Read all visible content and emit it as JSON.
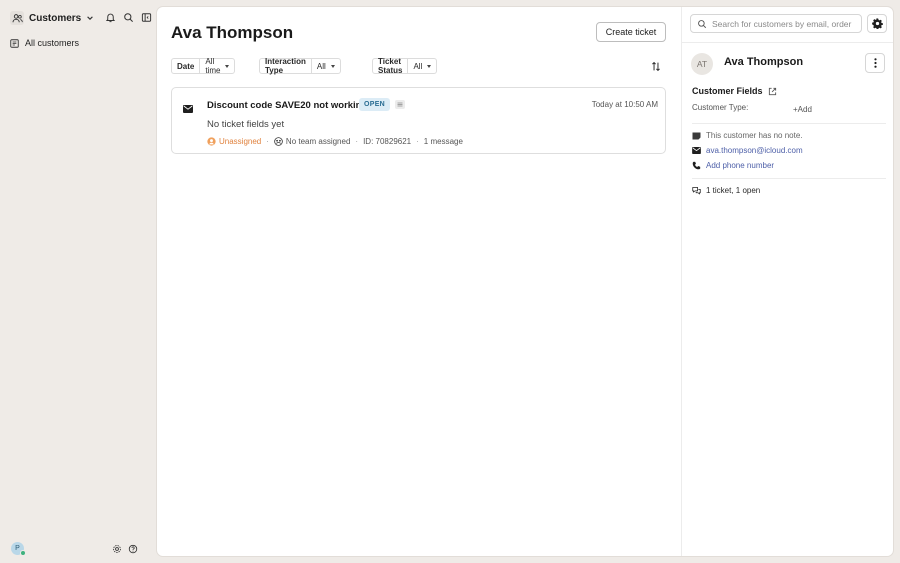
{
  "sidebar": {
    "app_label": "Customers",
    "nav_item": "All customers",
    "user_initial": "P",
    "icons": [
      "users-icon",
      "chevron-down-icon",
      "bell-icon",
      "search-icon",
      "panel-toggle-icon",
      "list-icon",
      "settings-icon",
      "help-icon"
    ]
  },
  "main": {
    "title": "Ava Thompson",
    "create_ticket_label": "Create ticket",
    "filters": [
      {
        "label": "Date",
        "value": "All time"
      },
      {
        "label": "Interaction Type",
        "value": "All"
      },
      {
        "label": "Ticket Status",
        "value": "All"
      }
    ],
    "ticket": {
      "subject": "Discount code SAVE20 not working",
      "status": "OPEN",
      "time": "Today at 10:50 AM",
      "fields_text": "No ticket fields yet",
      "assignee": "Unassigned",
      "team": "No team assigned",
      "id_text": "ID: 70829621",
      "messages": "1 message"
    }
  },
  "customer_panel": {
    "search_placeholder": "Search for customers by email, order",
    "initials": "AT",
    "name": "Ava Thompson",
    "fields_title": "Customer Fields",
    "field_label": "Customer Type:",
    "field_add": "+Add",
    "note": "This customer has no note.",
    "email": "ava.thompson@icloud.com",
    "phone_action": "Add phone number",
    "tickets_summary": "1 ticket, 1 open"
  },
  "colors": {
    "background": "#efebe7",
    "status_badge_bg": "#dcecf6",
    "status_badge_text": "#2a6d93",
    "unassigned": "#e0823e",
    "link": "#4d5fa8"
  }
}
